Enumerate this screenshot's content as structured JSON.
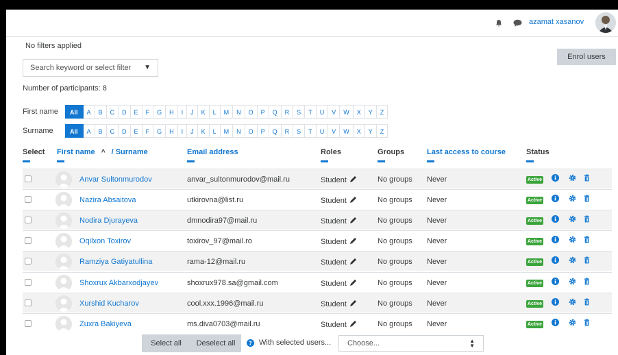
{
  "header": {
    "user_name": "azamat xasanov",
    "caret": "▾"
  },
  "filters": {
    "status": "No filters applied",
    "search_placeholder": "Search keyword or select filter",
    "enrol_label": "Enrol users"
  },
  "participants_label": "Number of participants: 8",
  "initials": {
    "first_label": "First name",
    "surname_label": "Surname",
    "all_label": "All",
    "letters": [
      "A",
      "B",
      "C",
      "D",
      "E",
      "F",
      "G",
      "H",
      "I",
      "J",
      "K",
      "L",
      "M",
      "N",
      "O",
      "P",
      "Q",
      "R",
      "S",
      "T",
      "U",
      "V",
      "W",
      "X",
      "Y",
      "Z"
    ]
  },
  "table": {
    "headers": {
      "select": "Select",
      "firstname": "First name",
      "sort_arrow": "^",
      "surname": "/ Surname",
      "email": "Email address",
      "roles": "Roles",
      "groups": "Groups",
      "last_access": "Last access to course",
      "status": "Status"
    },
    "rows": [
      {
        "name": "Anvar Sultonmurodov",
        "email": "anvar_sultonmurodov@mail.ru",
        "role": "Student",
        "groups": "No groups",
        "access": "Never",
        "status": "Active"
      },
      {
        "name": "Nazira Absaitova",
        "email": "utkirovna@list.ru",
        "role": "Student",
        "groups": "No groups",
        "access": "Never",
        "status": "Active"
      },
      {
        "name": "Nodira Djurayeva",
        "email": "dmnodira97@mail.ru",
        "role": "Student",
        "groups": "No groups",
        "access": "Never",
        "status": "Active"
      },
      {
        "name": "Oqilxon Toxirov",
        "email": "toxirov_97@mail.ro",
        "role": "Student",
        "groups": "No groups",
        "access": "Never",
        "status": "Active"
      },
      {
        "name": "Ramziya Gatiyatullina",
        "email": "rama-12@mail.ru",
        "role": "Student",
        "groups": "No groups",
        "access": "Never",
        "status": "Active"
      },
      {
        "name": "Shoxrux Akbarxodjayev",
        "email": "shoxrux978.sa@gmail.com",
        "role": "Student",
        "groups": "No groups",
        "access": "Never",
        "status": "Active"
      },
      {
        "name": "Xurshid Kucharov",
        "email": "cool.xxx.1996@mail.ru",
        "role": "Student",
        "groups": "No groups",
        "access": "Never",
        "status": "Active"
      },
      {
        "name": "Zuxra Bakiyeva",
        "email": "ms.diva0703@mail.ru",
        "role": "Student",
        "groups": "No groups",
        "access": "Never",
        "status": "Active"
      }
    ]
  },
  "bulk": {
    "select_all": "Select all",
    "deselect_all": "Deselect all",
    "with_selected": "With selected users...",
    "choose": "Choose..."
  },
  "colors": {
    "link": "#1177d1",
    "active_badge": "#3ca43c",
    "button_gray": "#ced4da"
  }
}
